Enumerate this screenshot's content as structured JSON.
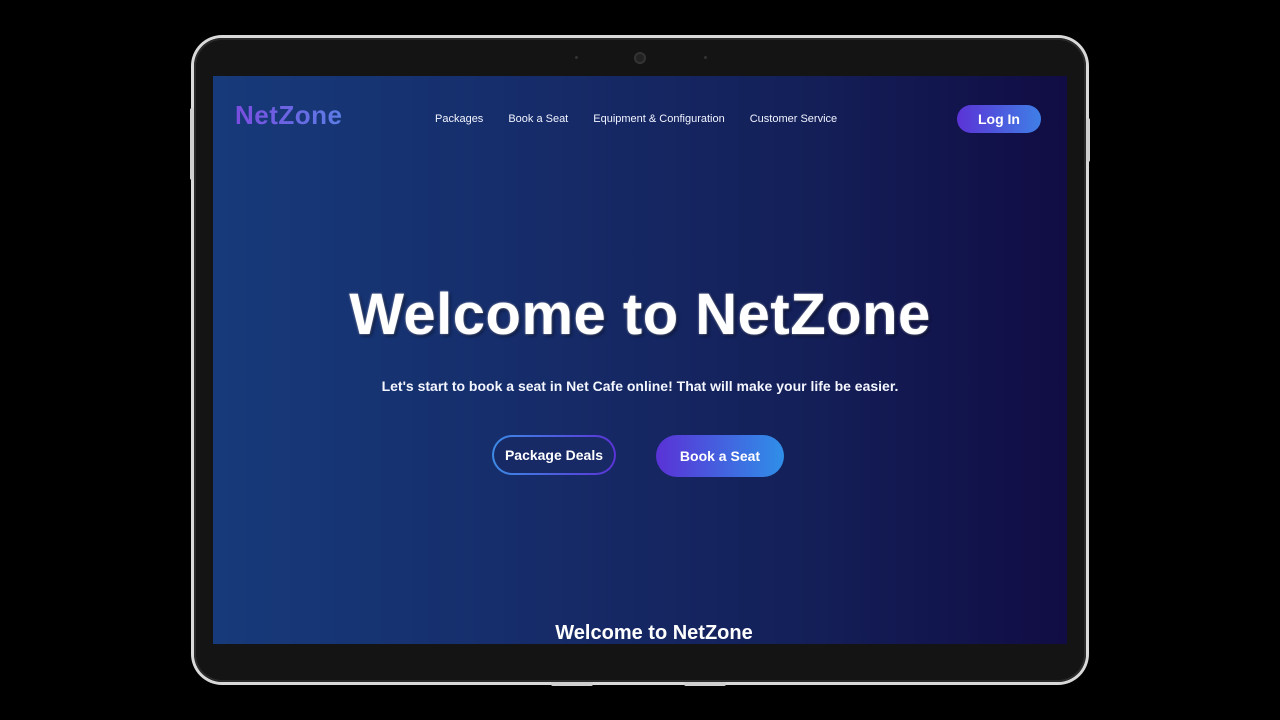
{
  "site": {
    "logo_text": "NetZone"
  },
  "nav": {
    "links": [
      {
        "label": "Packages"
      },
      {
        "label": "Book a Seat"
      },
      {
        "label": "Equipment & Configuration"
      },
      {
        "label": "Customer Service"
      }
    ],
    "login_label": "Log In"
  },
  "hero": {
    "title": "Welcome to NetZone",
    "subtitle": "Let's start to book a seat in Net Cafe online! That will make your life be easier.",
    "primary_cta": "Book a Seat",
    "secondary_cta": "Package Deals"
  },
  "next_section": {
    "title": "Welcome to NetZone"
  },
  "colors": {
    "page_bg": "#000000",
    "screen_gradient_start": "#173a7a",
    "screen_gradient_end": "#110c44",
    "accent_purple": "#5b33d6",
    "accent_blue": "#3f7fe6",
    "text_primary": "#ffffff"
  }
}
